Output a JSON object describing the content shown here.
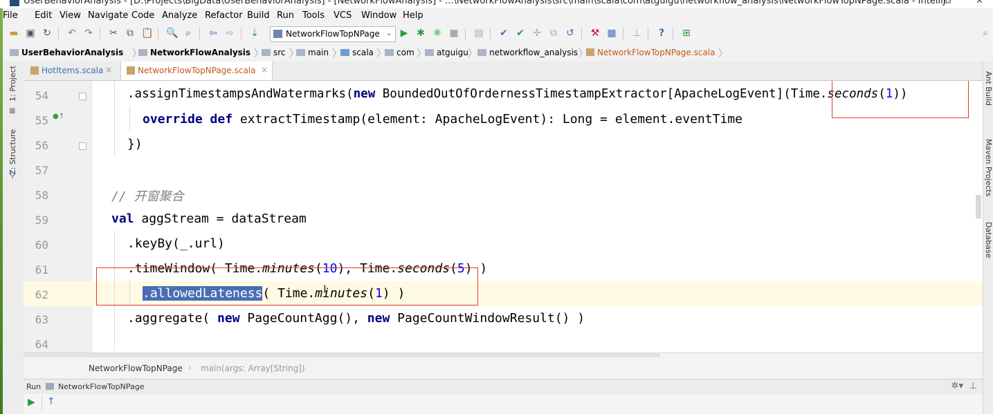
{
  "window": {
    "title": "UserBehaviorAnalysis - [D:\\Projects\\BigData\\UserBehaviorAnalysis] - [NetworkFlowAnalysis] - ...\\NetworkFlowAnalysis\\src\\main\\scala\\com\\atguigu\\networkflow_analysis\\NetworkFlowTopNPage.scala - IntelliJ",
    "minimize": "⧉",
    "close": "✕"
  },
  "menu": [
    "File",
    "Edit",
    "View",
    "Navigate",
    "Code",
    "Analyze",
    "Refactor",
    "Build",
    "Run",
    "Tools",
    "VCS",
    "Window",
    "Help"
  ],
  "toolbar": {
    "run_config": "NetworkFlowTopNPage",
    "help": "?"
  },
  "breadcrumb": [
    "UserBehaviorAnalysis",
    "NetworkFlowAnalysis",
    "src",
    "main",
    "scala",
    "com",
    "atguigu",
    "networkflow_analysis",
    "NetworkFlowTopNPage.scala"
  ],
  "left_tools": [
    "1: Project",
    "Z: Structure"
  ],
  "right_tools": [
    "Ant Build",
    "Maven Projects",
    "Database"
  ],
  "tabs": [
    {
      "label": "HotItems.scala",
      "close": "×"
    },
    {
      "label": "NetworkFlowTopNPage.scala",
      "close": "×"
    }
  ],
  "editor": {
    "lines": [
      {
        "n": "54",
        "code": ".assignTimestampsAndWatermarks(new BoundedOutOfOrdernessTimestampExtractor[ApacheLogEvent](Time.seconds(1))"
      },
      {
        "n": "55",
        "code": "override def extractTimestamp(element: ApacheLogEvent): Long = element.eventTime"
      },
      {
        "n": "56",
        "code": "})"
      },
      {
        "n": "57",
        "code": ""
      },
      {
        "n": "58",
        "code": "// 开窗聚合"
      },
      {
        "n": "59",
        "code": "val aggStream = dataStream"
      },
      {
        "n": "60",
        "code": ".keyBy(_.url)"
      },
      {
        "n": "61",
        "code": ".timeWindow( Time.minutes(10), Time.seconds(5) )"
      },
      {
        "n": "62",
        "code": ".allowedLateness( Time.minutes(1) )"
      },
      {
        "n": "63",
        "code": ".aggregate( new PageCountAgg(), new PageCountWindowResult() )"
      },
      {
        "n": "64",
        "code": ""
      }
    ],
    "selection": ".allowedLateness"
  },
  "editor_breadcrumb": {
    "object": "NetworkFlowTopNPage",
    "method": "main(args: Array[String])"
  },
  "run_panel": {
    "label": "Run",
    "config": "NetworkFlowTopNPage",
    "gear": "✲▾",
    "pin": "⊥"
  }
}
